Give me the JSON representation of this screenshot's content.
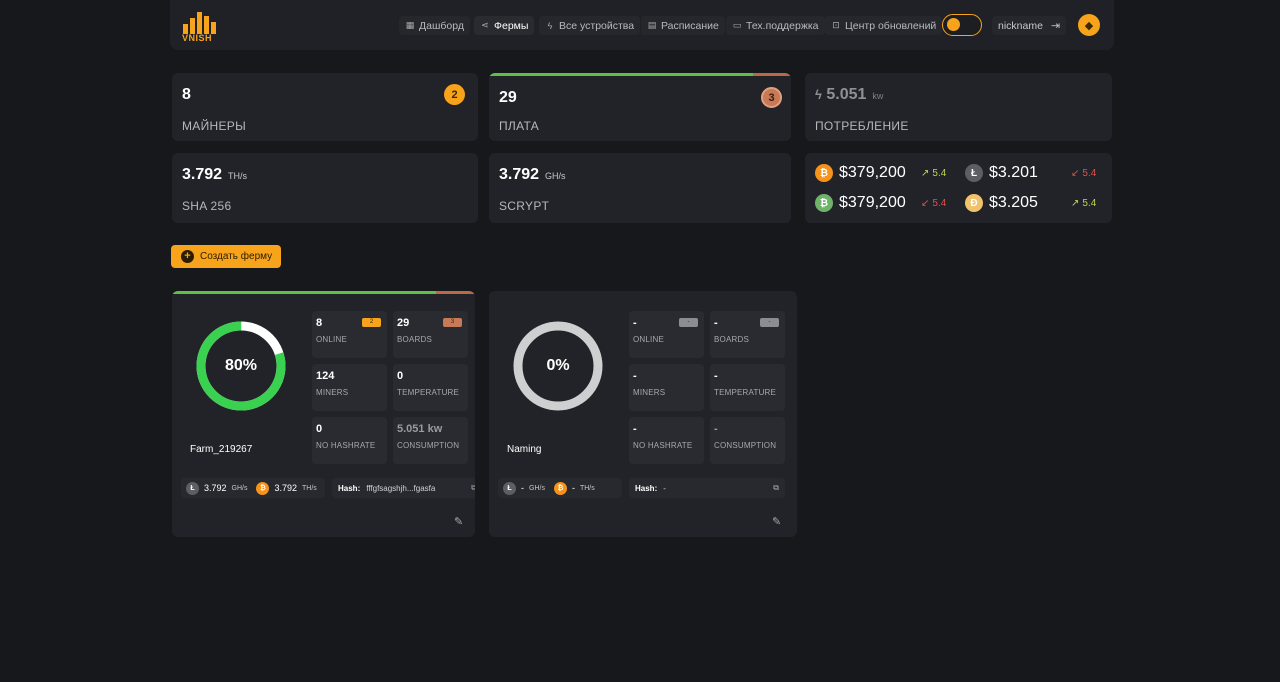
{
  "app": {
    "logo_text": "VNISH"
  },
  "nav": {
    "items": [
      {
        "label": "Дашборд",
        "icon": "grid-icon"
      },
      {
        "label": "Фермы",
        "icon": "share-icon"
      },
      {
        "label": "Все устройства",
        "icon": "bolt-icon"
      },
      {
        "label": "Расписание",
        "icon": "calendar-icon"
      },
      {
        "label": "Тех.поддержка",
        "icon": "chat-icon"
      },
      {
        "label": "Центр обновлений",
        "icon": "chip-icon"
      }
    ],
    "active": "Фермы",
    "username": "nickname"
  },
  "stats": {
    "miners": {
      "value": "8",
      "label": "МАЙНЕРЫ",
      "badge": "2"
    },
    "boards": {
      "value": "29",
      "label": "ПЛАТА",
      "badge": "3",
      "progress_green": 0.88
    },
    "consumption": {
      "value": "5.051",
      "unit": "kw",
      "label": "ПОТРЕБЛЕНИЕ"
    },
    "sha": {
      "value": "3.792",
      "unit": "TH/s",
      "label": "SHA 256"
    },
    "scrypt": {
      "value": "3.792",
      "unit": "GH/s",
      "label": "SCRYPT"
    }
  },
  "prices": [
    {
      "value": "$379,200",
      "trend": "5.4",
      "dir": "up",
      "color": "#f7931a",
      "symbol": "₿"
    },
    {
      "value": "$3.201",
      "trend": "5.4",
      "dir": "down",
      "color": "#5d5e64",
      "symbol": "Ł"
    },
    {
      "value": "$379,200",
      "trend": "5.4",
      "dir": "down",
      "color": "#6fb36b",
      "symbol": "₿"
    },
    {
      "value": "$3.205",
      "trend": "5.4",
      "dir": "up",
      "color": "#f0c26b",
      "symbol": "Ð"
    }
  ],
  "create_button": "Создать ферму",
  "farms": [
    {
      "name": "Farm_219267",
      "percent": "80%",
      "percent_value": 0.8,
      "progress_green": 0.84,
      "online": "8",
      "online_badge": "2",
      "boards": "29",
      "boards_badge": "3",
      "miners": "124",
      "temperature": "0",
      "no_hashrate": "0",
      "consumption": "5.051 kw",
      "ltc": "3.792",
      "ltc_unit": "GH/s",
      "btc": "3.792",
      "btc_unit": "TH/s",
      "hash_label": "Hash:",
      "hash": "fffgfsagshjh...fgasfa"
    },
    {
      "name": "Naming",
      "percent": "0%",
      "percent_value": 0,
      "online": "-",
      "online_badge": "-",
      "boards": "-",
      "boards_badge": "-",
      "miners": "-",
      "temperature": "-",
      "no_hashrate": "-",
      "consumption": "-",
      "ltc": "-",
      "ltc_unit": "GH/s",
      "btc": "-",
      "btc_unit": "TH/s",
      "hash_label": "Hash:",
      "hash": "-"
    }
  ],
  "labels": {
    "online": "ONLINE",
    "boards": "BOARDS",
    "miners": "MINERS",
    "temperature": "TEMPERATURE",
    "no_hashrate": "NO HASHRATE",
    "consumption": "CONSUMPTION"
  }
}
